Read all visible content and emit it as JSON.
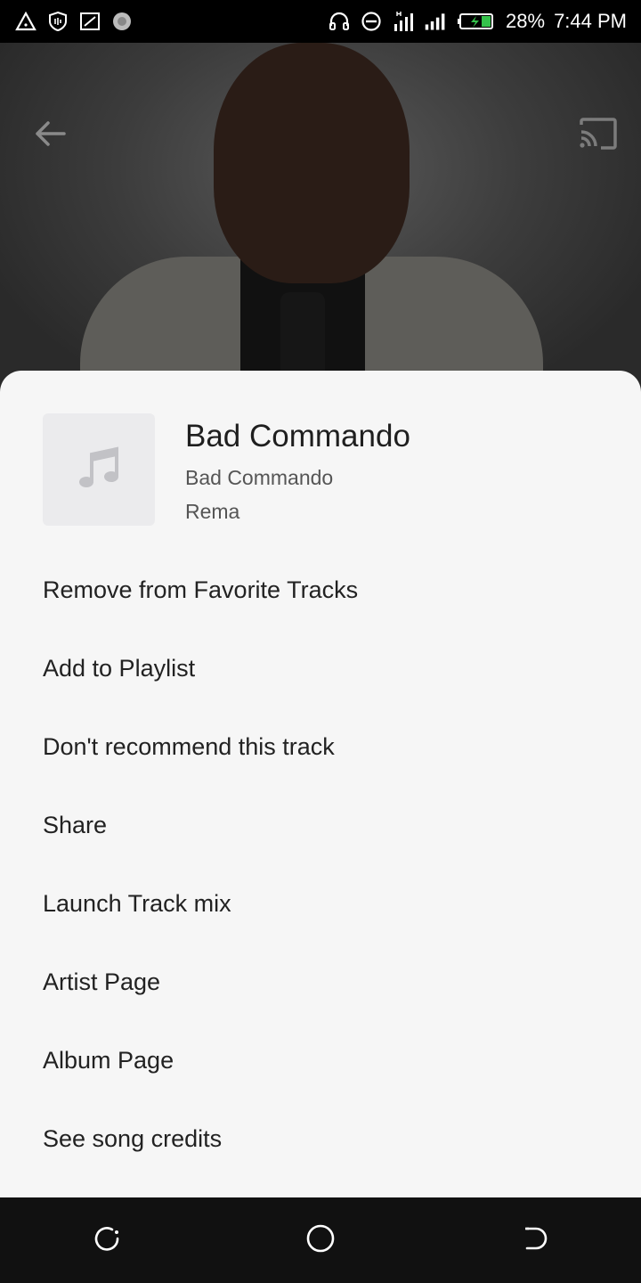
{
  "status_bar": {
    "battery": "28%",
    "time": "7:44 PM"
  },
  "header": {
    "back_icon": "arrow-left-icon",
    "cast_icon": "cast-icon"
  },
  "track": {
    "title": "Bad Commando",
    "album": "Bad Commando",
    "artist": "Rema",
    "cover_icon": "music-note-icon"
  },
  "menu": [
    {
      "label": "Remove from Favorite Tracks"
    },
    {
      "label": "Add to Playlist"
    },
    {
      "label": "Don't recommend this track"
    },
    {
      "label": "Share"
    },
    {
      "label": "Launch Track mix"
    },
    {
      "label": "Artist Page"
    },
    {
      "label": "Album Page"
    },
    {
      "label": "See song credits"
    }
  ],
  "colors": {
    "sheet_background": "#f6f6f6",
    "text_primary": "#1f1f1f",
    "text_secondary": "#555555"
  }
}
